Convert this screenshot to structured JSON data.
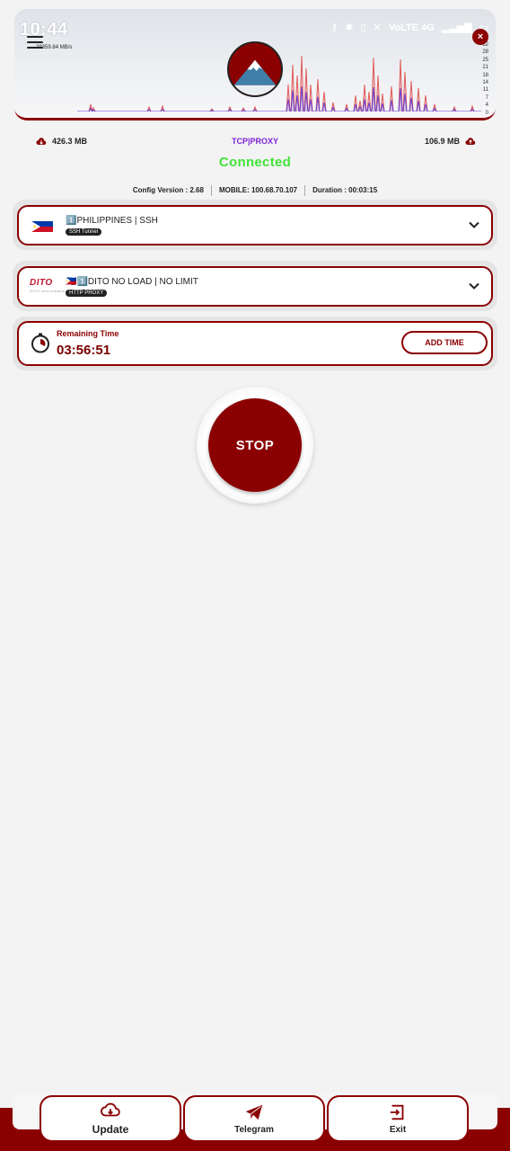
{
  "status_bar": {
    "time": "10:44",
    "network": "VoLTE 4G"
  },
  "header": {
    "speed": "29359.84 MB/s",
    "graph_axis": [
      "32",
      "28",
      "25",
      "21",
      "18",
      "14",
      "11",
      "7",
      "4",
      "0"
    ]
  },
  "stats": {
    "download": "426.3 MB",
    "protocol": "TCP|PROXY",
    "upload": "106.9 MB"
  },
  "connection": {
    "status": "Connected",
    "status_color": "#42e23a"
  },
  "info": {
    "config_version": "Config Version : 2.68",
    "mobile_ip": "MOBILE: 100.68.70.107",
    "duration": "Duration : 00:03:15"
  },
  "server": {
    "label": "1️⃣PHILIPPINES | SSH",
    "tag": "SSH Tunnel",
    "icon": "philippines-flag-icon"
  },
  "payload": {
    "label": "🇵🇭1️⃣DITO NO LOAD | NO LIMIT",
    "tag": "HTTP PROXY",
    "logo": "DITO",
    "logo_sub": "DITO telecommunity"
  },
  "timer": {
    "label": "Remaining Time",
    "value": "03:56:51",
    "button": "ADD TIME"
  },
  "stop_button": {
    "label": "STOP"
  },
  "nav": {
    "update": "Update",
    "telegram": "Telegram",
    "exit": "Exit"
  },
  "colors": {
    "accent": "#8b0000",
    "protocol": "#7b21d6"
  }
}
